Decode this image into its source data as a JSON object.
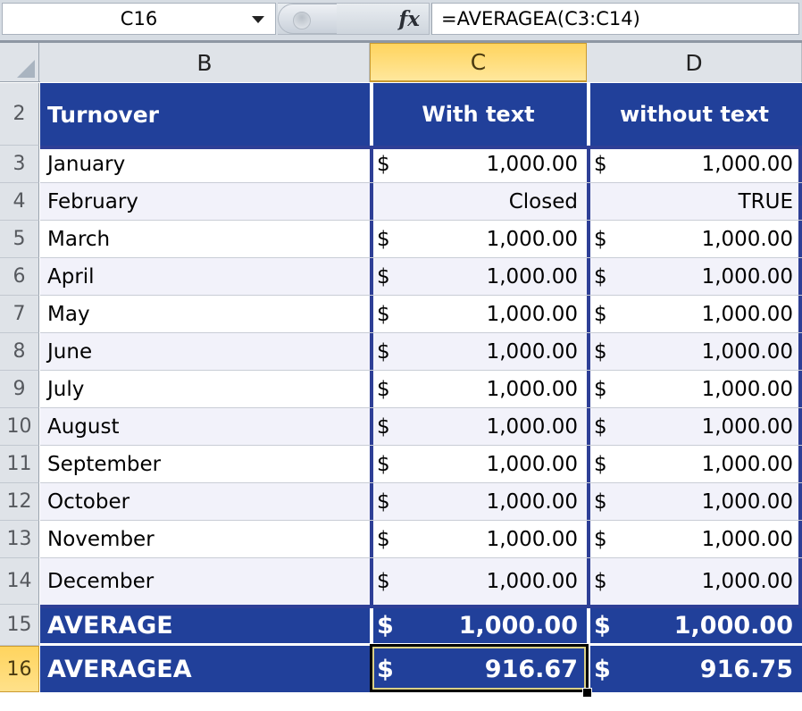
{
  "formula_bar": {
    "name_box_value": "C16",
    "name_box_arrow_icon": "chevron-down-icon",
    "fx_label": "fx",
    "formula_value": "=AVERAGEA(C3:C14)"
  },
  "grid": {
    "selected_column": "C",
    "selected_row": "16",
    "active_cell": "C16",
    "column_headers": [
      "B",
      "C",
      "D"
    ],
    "row_headers": [
      "2",
      "3",
      "4",
      "5",
      "6",
      "7",
      "8",
      "9",
      "10",
      "11",
      "12",
      "13",
      "14",
      "15",
      "16"
    ],
    "table_header": {
      "label": "Turnover",
      "col_c": "With text",
      "col_d": "without text"
    },
    "rows": [
      {
        "row": "3",
        "label": "January",
        "c_cur": "$",
        "c_val": "1,000.00",
        "d_cur": "$",
        "d_val": "1,000.00"
      },
      {
        "row": "4",
        "label": "February",
        "c_cur": "",
        "c_val": "Closed",
        "d_cur": "",
        "d_val": "TRUE"
      },
      {
        "row": "5",
        "label": "March",
        "c_cur": "$",
        "c_val": "1,000.00",
        "d_cur": "$",
        "d_val": "1,000.00"
      },
      {
        "row": "6",
        "label": "April",
        "c_cur": "$",
        "c_val": "1,000.00",
        "d_cur": "$",
        "d_val": "1,000.00"
      },
      {
        "row": "7",
        "label": "May",
        "c_cur": "$",
        "c_val": "1,000.00",
        "d_cur": "$",
        "d_val": "1,000.00"
      },
      {
        "row": "8",
        "label": "June",
        "c_cur": "$",
        "c_val": "1,000.00",
        "d_cur": "$",
        "d_val": "1,000.00"
      },
      {
        "row": "9",
        "label": "July",
        "c_cur": "$",
        "c_val": "1,000.00",
        "d_cur": "$",
        "d_val": "1,000.00"
      },
      {
        "row": "10",
        "label": "August",
        "c_cur": "$",
        "c_val": "1,000.00",
        "d_cur": "$",
        "d_val": "1,000.00"
      },
      {
        "row": "11",
        "label": "September",
        "c_cur": "$",
        "c_val": "1,000.00",
        "d_cur": "$",
        "d_val": "1,000.00"
      },
      {
        "row": "12",
        "label": "October",
        "c_cur": "$",
        "c_val": "1,000.00",
        "d_cur": "$",
        "d_val": "1,000.00"
      },
      {
        "row": "13",
        "label": "November",
        "c_cur": "$",
        "c_val": "1,000.00",
        "d_cur": "$",
        "d_val": "1,000.00"
      },
      {
        "row": "14",
        "label": "December",
        "c_cur": "$",
        "c_val": "1,000.00",
        "d_cur": "$",
        "d_val": "1,000.00"
      }
    ],
    "totals": [
      {
        "row": "15",
        "label": "AVERAGE",
        "c_cur": "$",
        "c_val": "1,000.00",
        "d_cur": "$",
        "d_val": "1,000.00"
      },
      {
        "row": "16",
        "label": "AVERAGEA",
        "c_cur": "$",
        "c_val": "916.67",
        "d_cur": "$",
        "d_val": "916.75"
      }
    ]
  },
  "colors": {
    "header_blue": "#21409a",
    "selection_amber": "#ffd45e",
    "band": "#f2f2fa",
    "grid_chrome": "#dfe3e8",
    "active_border": "#000000"
  }
}
